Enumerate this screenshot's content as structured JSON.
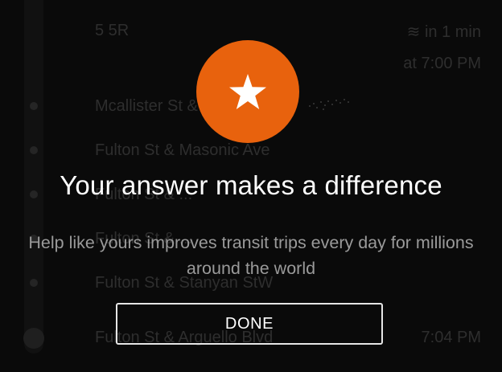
{
  "background": {
    "route": {
      "name": "5 5R",
      "arrival_relative": "in 1 min",
      "arrival_time": "at 7:00 PM"
    },
    "stops": [
      {
        "name": "Mcallister St & ...",
        "time": ""
      },
      {
        "name": "Fulton St & Masonic Ave",
        "time": ""
      },
      {
        "name": "Fulton St & ...",
        "time": ""
      },
      {
        "name": "Fulton St & ...",
        "time": ""
      },
      {
        "name": "Fulton St & Stanyan StW",
        "time": ""
      },
      {
        "name": "Fulton St & Arguello Blvd",
        "time": "7:04 PM"
      }
    ]
  },
  "overlay": {
    "badge_icon": "star-icon",
    "accent_color": "#e8620d",
    "headline": "Your answer makes a difference",
    "subtext": "Help like yours improves transit trips every day for millions around the world",
    "done_label": "DONE"
  }
}
